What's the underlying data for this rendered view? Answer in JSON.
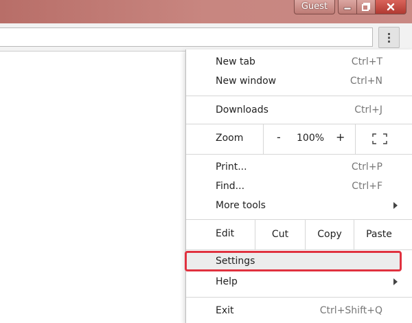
{
  "titlebar": {
    "profile_label": "Guest",
    "controls": {
      "minimize": "minimize-icon",
      "restore": "restore-icon",
      "close": "close-icon"
    }
  },
  "toolbar": {
    "menu_icon": "vertical-dots-icon"
  },
  "menu": {
    "new_tab": {
      "label": "New tab",
      "shortcut": "Ctrl+T"
    },
    "new_window": {
      "label": "New window",
      "shortcut": "Ctrl+N"
    },
    "downloads": {
      "label": "Downloads",
      "shortcut": "Ctrl+J"
    },
    "zoom": {
      "label": "Zoom",
      "minus": "-",
      "value": "100%",
      "plus": "+",
      "fullscreen_icon": "fullscreen-icon"
    },
    "print": {
      "label": "Print...",
      "shortcut": "Ctrl+P"
    },
    "find": {
      "label": "Find...",
      "shortcut": "Ctrl+F"
    },
    "more_tools": {
      "label": "More tools",
      "icon": "chevron-right-icon"
    },
    "edit": {
      "label": "Edit",
      "cut": "Cut",
      "copy": "Copy",
      "paste": "Paste"
    },
    "settings": {
      "label": "Settings",
      "highlight_color": "#e0313f"
    },
    "help": {
      "label": "Help",
      "icon": "chevron-right-icon"
    },
    "exit": {
      "label": "Exit",
      "shortcut": "Ctrl+Shift+Q"
    }
  },
  "colors": {
    "titlebar": "#c48079",
    "highlight": "#e0313f"
  }
}
